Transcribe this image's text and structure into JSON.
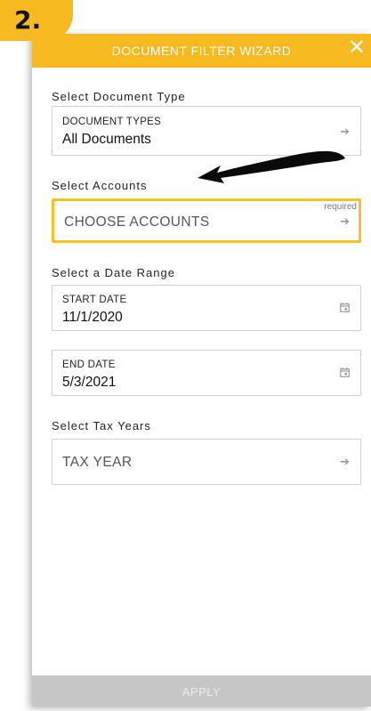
{
  "step_badge": "2.",
  "header": {
    "title": "DOCUMENT FILTER WIZARD",
    "close_icon": "close-icon"
  },
  "document_type": {
    "section_label": "Select Document Type",
    "field_label": "DOCUMENT TYPES",
    "value": "All Documents",
    "icon": "arrow-right-icon"
  },
  "accounts": {
    "section_label": "Select Accounts",
    "placeholder": "CHOOSE ACCOUNTS",
    "required_label": "required",
    "icon": "arrow-right-icon"
  },
  "date_range": {
    "section_label": "Select a Date Range",
    "start": {
      "label": "START DATE",
      "value": "11/1/2020",
      "icon": "calendar-icon"
    },
    "end": {
      "label": "END DATE",
      "value": "5/3/2021",
      "icon": "calendar-icon"
    }
  },
  "tax_years": {
    "section_label": "Select Tax Years",
    "placeholder": "TAX YEAR",
    "icon": "arrow-right-icon"
  },
  "footer": {
    "apply_label": "APPLY"
  },
  "colors": {
    "accent": "#f6b91f",
    "highlight_border": "#f6c31d",
    "apply_disabled": "#c6c6c6"
  }
}
